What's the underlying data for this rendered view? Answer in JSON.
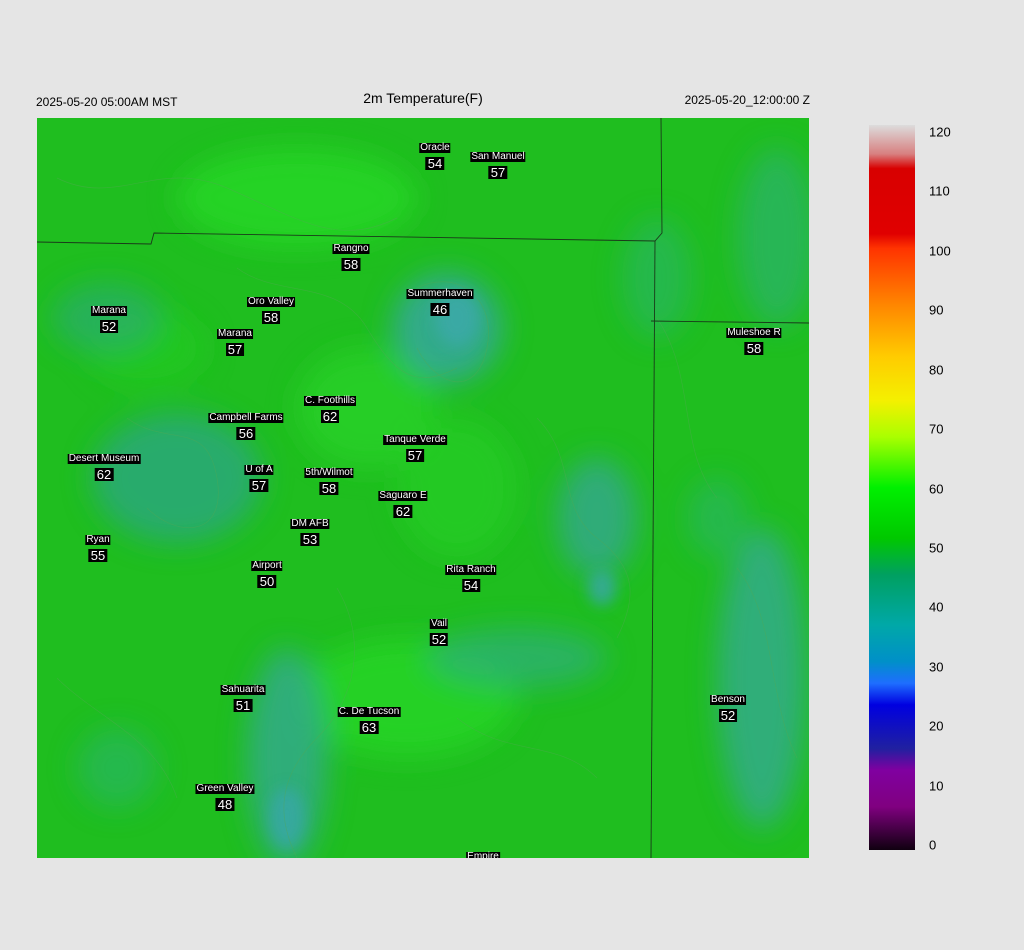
{
  "header": {
    "local_time": "2025-05-20 05:00AM MST",
    "title": "2m Temperature(F)",
    "valid_time": "2025-05-20_12:00:00 Z"
  },
  "stations": [
    {
      "name": "Oracle",
      "value": "54"
    },
    {
      "name": "San Manuel",
      "value": "57"
    },
    {
      "name": "Rangno",
      "value": "58"
    },
    {
      "name": "Summerhaven",
      "value": "46"
    },
    {
      "name": "Oro Valley",
      "value": "58"
    },
    {
      "name": "Marana",
      "value": "52"
    },
    {
      "name": "Marana",
      "value": "57"
    },
    {
      "name": "Muleshoe R",
      "value": "58"
    },
    {
      "name": "C. Foothills",
      "value": "62"
    },
    {
      "name": "Campbell Farms",
      "value": "56"
    },
    {
      "name": "Tanque Verde",
      "value": "57"
    },
    {
      "name": "Desert Museum",
      "value": "62"
    },
    {
      "name": "U of A",
      "value": "57"
    },
    {
      "name": "5th/Wilmot",
      "value": "58"
    },
    {
      "name": "Saguaro E",
      "value": "62"
    },
    {
      "name": "DM AFB",
      "value": "53"
    },
    {
      "name": "Ryan",
      "value": "55"
    },
    {
      "name": "Airport",
      "value": "50"
    },
    {
      "name": "Rita Ranch",
      "value": "54"
    },
    {
      "name": "Vail",
      "value": "52"
    },
    {
      "name": "Sahuarita",
      "value": "51"
    },
    {
      "name": "C. De Tucson",
      "value": "63"
    },
    {
      "name": "Benson",
      "value": "52"
    },
    {
      "name": "Green Valley",
      "value": "48"
    },
    {
      "name": "Empire",
      "value": ""
    }
  ],
  "colorbar": {
    "ticks": [
      "120",
      "110",
      "100",
      "90",
      "80",
      "70",
      "60",
      "50",
      "40",
      "30",
      "20",
      "10",
      "0"
    ],
    "min": 0,
    "max": 120
  },
  "colors": {
    "background": "#e5e5e5",
    "field_base": "#1fc01f",
    "field_warm": "#22d622",
    "field_cool": "#2fb28a"
  }
}
